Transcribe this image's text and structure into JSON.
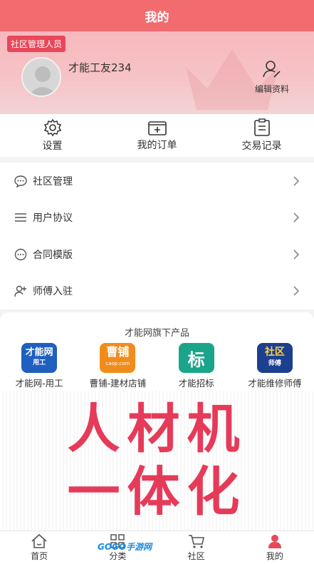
{
  "header": {
    "title": "我的"
  },
  "profile": {
    "role_badge": "社区管理人员",
    "username": "才能工友234",
    "edit_label": "编辑资料"
  },
  "quick_actions": [
    {
      "label": "设置",
      "icon": "gear-icon"
    },
    {
      "label": "我的订单",
      "icon": "add-box-icon"
    },
    {
      "label": "交易记录",
      "icon": "clipboard-icon"
    }
  ],
  "menu": [
    {
      "label": "社区管理",
      "icon": "chat-bubble-icon"
    },
    {
      "label": "用户协议",
      "icon": "hamburger-lines-icon"
    },
    {
      "label": "合同模版",
      "icon": "dots-circle-icon"
    },
    {
      "label": "师傅入驻",
      "icon": "add-user-icon"
    }
  ],
  "products": {
    "title": "才能网旗下产品",
    "apps": [
      {
        "label": "才能网-用工",
        "icon_text": "才能网",
        "sub_text": "用工",
        "color": "#1f5fbf"
      },
      {
        "label": "曹铺-建材店铺",
        "icon_text": "曹铺",
        "sub_text": "caop.com",
        "color": "#f08c1c"
      },
      {
        "label": "才能招标",
        "icon_text": "标",
        "sub_text": "",
        "color": "#1aa58a"
      },
      {
        "label": "才能维修师傅",
        "icon_text": "社区",
        "sub_text": "师傅",
        "color": "#1d3f8f"
      }
    ]
  },
  "banner": {
    "line1": "人材机",
    "line2": "一体化",
    "color": "#e63a59"
  },
  "tabbar": [
    {
      "label": "首页",
      "icon": "home-icon"
    },
    {
      "label": "分类",
      "icon": "grid-icon"
    },
    {
      "label": "社区",
      "icon": "cart-icon"
    },
    {
      "label": "我的",
      "icon": "person-icon",
      "active": true
    }
  ],
  "watermark": "GOGO手游网",
  "colors": {
    "primary": "#f26b6f",
    "badge": "#e8485a",
    "active_tab": "#e8485a"
  }
}
